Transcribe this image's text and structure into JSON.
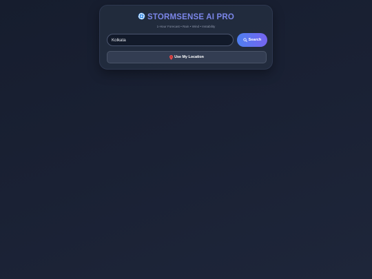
{
  "app": {
    "title": "STORMSENSE AI PRO",
    "subtitle": "1-Hour Forecast • Rain • Wind • Instability",
    "logo_icon": "cyclone-icon",
    "title_color": "#7b86e8"
  },
  "search": {
    "value": "Kolkata",
    "button_label": "Search",
    "button_icon": "search-icon"
  },
  "location": {
    "button_label": "Use My Location",
    "button_icon": "pin-icon",
    "pin_color": "#e84b4b"
  },
  "colors": {
    "accent_start": "#4e7ff0",
    "accent_end": "#7664f0",
    "background": "#1a2134"
  }
}
